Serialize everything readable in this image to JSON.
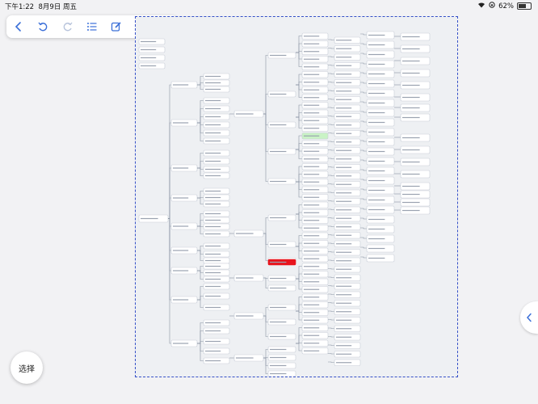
{
  "statusbar": {
    "time": "下午1:22",
    "date": "8月9日 周五",
    "battery": "62%",
    "battery_level": 0.62
  },
  "toolbar": {
    "buttons": [
      {
        "name": "back-button",
        "icon": "chevron-left-icon"
      },
      {
        "name": "undo-button",
        "icon": "undo-icon"
      },
      {
        "name": "redo-button",
        "icon": "redo-icon"
      },
      {
        "name": "outline-button",
        "icon": "list-icon"
      },
      {
        "name": "edit-button",
        "icon": "pencil-square-icon"
      },
      {
        "name": "share-button",
        "icon": "share-icon"
      },
      {
        "name": "more-button",
        "icon": "ellipsis-icon"
      }
    ]
  },
  "select_button": {
    "label": "选择"
  },
  "colors": {
    "accent": "#3b6fd8",
    "highlight_red": "#e8141d",
    "highlight_green": "#c9f3c5",
    "border": "#3550c8"
  }
}
